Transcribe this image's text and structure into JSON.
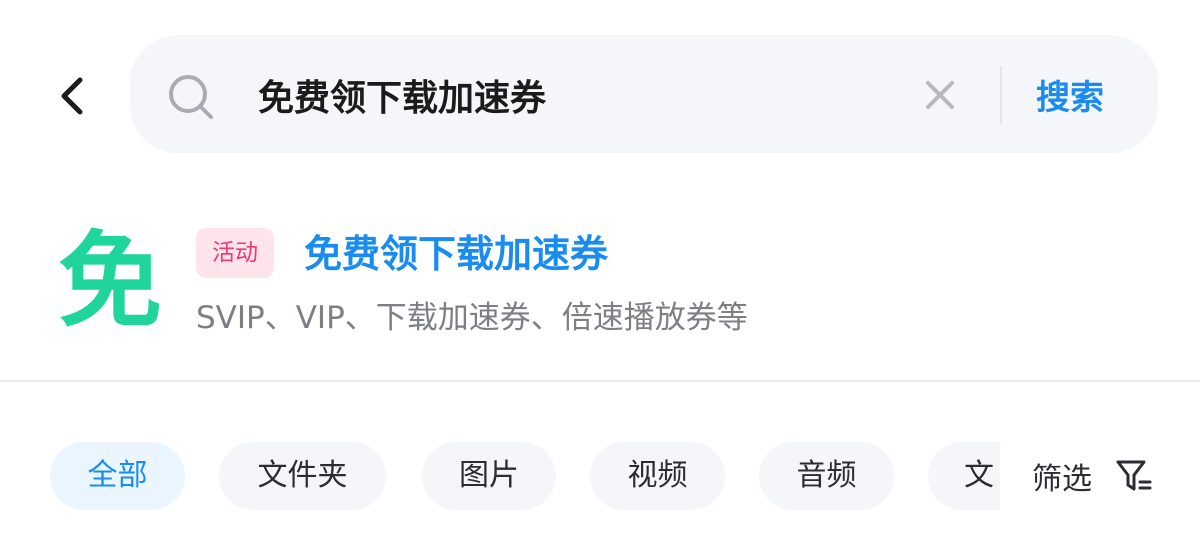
{
  "header": {
    "search": {
      "value": "免费领下载加速券",
      "placeholder": ""
    },
    "search_button_label": "搜索"
  },
  "promo": {
    "icon_char": "免",
    "badge": "活动",
    "title": "免费领下载加速券",
    "description": "SVIP、VIP、下载加速券、倍速播放券等",
    "icon_color": "#1fd59b",
    "title_color": "#1a8cf0",
    "badge_color": "#f03a74"
  },
  "filters": {
    "chips": [
      {
        "label": "全部",
        "active": true
      },
      {
        "label": "文件夹",
        "active": false
      },
      {
        "label": "图片",
        "active": false
      },
      {
        "label": "视频",
        "active": false
      },
      {
        "label": "音频",
        "active": false
      },
      {
        "label": "文",
        "active": false
      }
    ],
    "filter_button_label": "筛选"
  },
  "colors": {
    "accent": "#1a8cf0",
    "chip_bg": "#f5f6fa",
    "chip_active_bg": "#eaf5ff"
  }
}
